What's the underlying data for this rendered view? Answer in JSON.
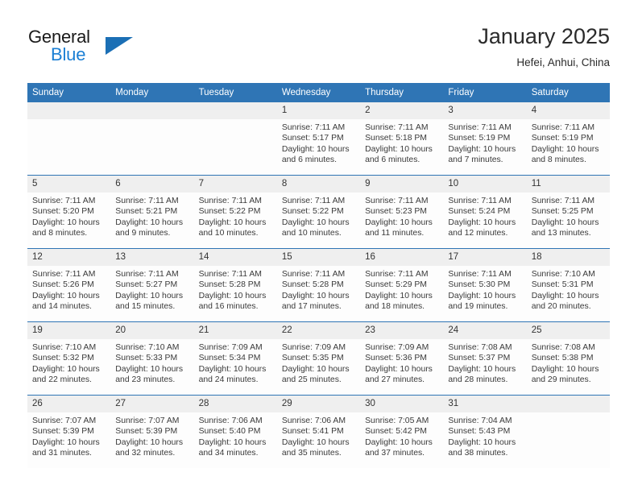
{
  "brand": {
    "name_part1": "General",
    "name_part2": "Blue",
    "flag_icon": "triangle-flag-icon",
    "accent_color": "#1b7fd4"
  },
  "header": {
    "title": "January 2025",
    "subtitle": "Hefei, Anhui, China"
  },
  "calendar": {
    "header_bg": "#2f75b5",
    "daynum_bg": "#efefef",
    "weekday_headers": [
      "Sunday",
      "Monday",
      "Tuesday",
      "Wednesday",
      "Thursday",
      "Friday",
      "Saturday"
    ],
    "weeks": [
      [
        {
          "day": "",
          "sunrise": "",
          "sunset": "",
          "daylight1": "",
          "daylight2": "",
          "empty": true
        },
        {
          "day": "",
          "sunrise": "",
          "sunset": "",
          "daylight1": "",
          "daylight2": "",
          "empty": true
        },
        {
          "day": "",
          "sunrise": "",
          "sunset": "",
          "daylight1": "",
          "daylight2": "",
          "empty": true
        },
        {
          "day": "1",
          "sunrise": "Sunrise: 7:11 AM",
          "sunset": "Sunset: 5:17 PM",
          "daylight1": "Daylight: 10 hours",
          "daylight2": "and 6 minutes."
        },
        {
          "day": "2",
          "sunrise": "Sunrise: 7:11 AM",
          "sunset": "Sunset: 5:18 PM",
          "daylight1": "Daylight: 10 hours",
          "daylight2": "and 6 minutes."
        },
        {
          "day": "3",
          "sunrise": "Sunrise: 7:11 AM",
          "sunset": "Sunset: 5:19 PM",
          "daylight1": "Daylight: 10 hours",
          "daylight2": "and 7 minutes."
        },
        {
          "day": "4",
          "sunrise": "Sunrise: 7:11 AM",
          "sunset": "Sunset: 5:19 PM",
          "daylight1": "Daylight: 10 hours",
          "daylight2": "and 8 minutes."
        }
      ],
      [
        {
          "day": "5",
          "sunrise": "Sunrise: 7:11 AM",
          "sunset": "Sunset: 5:20 PM",
          "daylight1": "Daylight: 10 hours",
          "daylight2": "and 8 minutes."
        },
        {
          "day": "6",
          "sunrise": "Sunrise: 7:11 AM",
          "sunset": "Sunset: 5:21 PM",
          "daylight1": "Daylight: 10 hours",
          "daylight2": "and 9 minutes."
        },
        {
          "day": "7",
          "sunrise": "Sunrise: 7:11 AM",
          "sunset": "Sunset: 5:22 PM",
          "daylight1": "Daylight: 10 hours",
          "daylight2": "and 10 minutes."
        },
        {
          "day": "8",
          "sunrise": "Sunrise: 7:11 AM",
          "sunset": "Sunset: 5:22 PM",
          "daylight1": "Daylight: 10 hours",
          "daylight2": "and 10 minutes."
        },
        {
          "day": "9",
          "sunrise": "Sunrise: 7:11 AM",
          "sunset": "Sunset: 5:23 PM",
          "daylight1": "Daylight: 10 hours",
          "daylight2": "and 11 minutes."
        },
        {
          "day": "10",
          "sunrise": "Sunrise: 7:11 AM",
          "sunset": "Sunset: 5:24 PM",
          "daylight1": "Daylight: 10 hours",
          "daylight2": "and 12 minutes."
        },
        {
          "day": "11",
          "sunrise": "Sunrise: 7:11 AM",
          "sunset": "Sunset: 5:25 PM",
          "daylight1": "Daylight: 10 hours",
          "daylight2": "and 13 minutes."
        }
      ],
      [
        {
          "day": "12",
          "sunrise": "Sunrise: 7:11 AM",
          "sunset": "Sunset: 5:26 PM",
          "daylight1": "Daylight: 10 hours",
          "daylight2": "and 14 minutes."
        },
        {
          "day": "13",
          "sunrise": "Sunrise: 7:11 AM",
          "sunset": "Sunset: 5:27 PM",
          "daylight1": "Daylight: 10 hours",
          "daylight2": "and 15 minutes."
        },
        {
          "day": "14",
          "sunrise": "Sunrise: 7:11 AM",
          "sunset": "Sunset: 5:28 PM",
          "daylight1": "Daylight: 10 hours",
          "daylight2": "and 16 minutes."
        },
        {
          "day": "15",
          "sunrise": "Sunrise: 7:11 AM",
          "sunset": "Sunset: 5:28 PM",
          "daylight1": "Daylight: 10 hours",
          "daylight2": "and 17 minutes."
        },
        {
          "day": "16",
          "sunrise": "Sunrise: 7:11 AM",
          "sunset": "Sunset: 5:29 PM",
          "daylight1": "Daylight: 10 hours",
          "daylight2": "and 18 minutes."
        },
        {
          "day": "17",
          "sunrise": "Sunrise: 7:11 AM",
          "sunset": "Sunset: 5:30 PM",
          "daylight1": "Daylight: 10 hours",
          "daylight2": "and 19 minutes."
        },
        {
          "day": "18",
          "sunrise": "Sunrise: 7:10 AM",
          "sunset": "Sunset: 5:31 PM",
          "daylight1": "Daylight: 10 hours",
          "daylight2": "and 20 minutes."
        }
      ],
      [
        {
          "day": "19",
          "sunrise": "Sunrise: 7:10 AM",
          "sunset": "Sunset: 5:32 PM",
          "daylight1": "Daylight: 10 hours",
          "daylight2": "and 22 minutes."
        },
        {
          "day": "20",
          "sunrise": "Sunrise: 7:10 AM",
          "sunset": "Sunset: 5:33 PM",
          "daylight1": "Daylight: 10 hours",
          "daylight2": "and 23 minutes."
        },
        {
          "day": "21",
          "sunrise": "Sunrise: 7:09 AM",
          "sunset": "Sunset: 5:34 PM",
          "daylight1": "Daylight: 10 hours",
          "daylight2": "and 24 minutes."
        },
        {
          "day": "22",
          "sunrise": "Sunrise: 7:09 AM",
          "sunset": "Sunset: 5:35 PM",
          "daylight1": "Daylight: 10 hours",
          "daylight2": "and 25 minutes."
        },
        {
          "day": "23",
          "sunrise": "Sunrise: 7:09 AM",
          "sunset": "Sunset: 5:36 PM",
          "daylight1": "Daylight: 10 hours",
          "daylight2": "and 27 minutes."
        },
        {
          "day": "24",
          "sunrise": "Sunrise: 7:08 AM",
          "sunset": "Sunset: 5:37 PM",
          "daylight1": "Daylight: 10 hours",
          "daylight2": "and 28 minutes."
        },
        {
          "day": "25",
          "sunrise": "Sunrise: 7:08 AM",
          "sunset": "Sunset: 5:38 PM",
          "daylight1": "Daylight: 10 hours",
          "daylight2": "and 29 minutes."
        }
      ],
      [
        {
          "day": "26",
          "sunrise": "Sunrise: 7:07 AM",
          "sunset": "Sunset: 5:39 PM",
          "daylight1": "Daylight: 10 hours",
          "daylight2": "and 31 minutes."
        },
        {
          "day": "27",
          "sunrise": "Sunrise: 7:07 AM",
          "sunset": "Sunset: 5:39 PM",
          "daylight1": "Daylight: 10 hours",
          "daylight2": "and 32 minutes."
        },
        {
          "day": "28",
          "sunrise": "Sunrise: 7:06 AM",
          "sunset": "Sunset: 5:40 PM",
          "daylight1": "Daylight: 10 hours",
          "daylight2": "and 34 minutes."
        },
        {
          "day": "29",
          "sunrise": "Sunrise: 7:06 AM",
          "sunset": "Sunset: 5:41 PM",
          "daylight1": "Daylight: 10 hours",
          "daylight2": "and 35 minutes."
        },
        {
          "day": "30",
          "sunrise": "Sunrise: 7:05 AM",
          "sunset": "Sunset: 5:42 PM",
          "daylight1": "Daylight: 10 hours",
          "daylight2": "and 37 minutes."
        },
        {
          "day": "31",
          "sunrise": "Sunrise: 7:04 AM",
          "sunset": "Sunset: 5:43 PM",
          "daylight1": "Daylight: 10 hours",
          "daylight2": "and 38 minutes."
        },
        {
          "day": "",
          "sunrise": "",
          "sunset": "",
          "daylight1": "",
          "daylight2": "",
          "empty": true
        }
      ]
    ]
  }
}
